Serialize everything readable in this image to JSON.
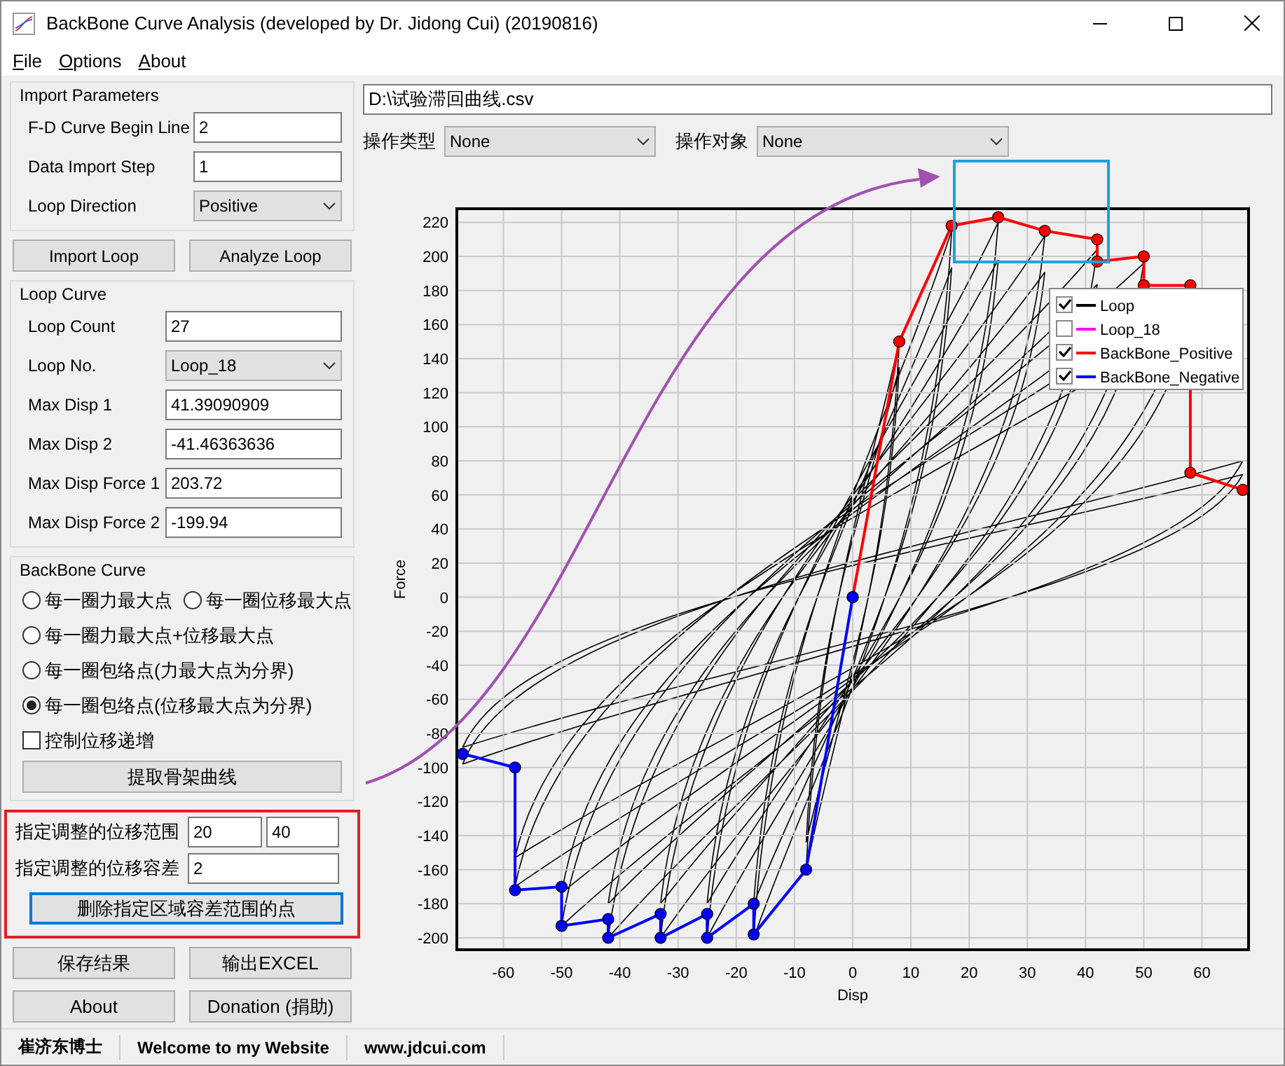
{
  "window": {
    "title": "BackBone Curve Analysis (developed by Dr. Jidong Cui) (20190816)"
  },
  "menu": [
    "File",
    "Options",
    "About"
  ],
  "import_parameters": {
    "title": "Import Parameters",
    "fields": [
      {
        "label": "F-D Curve Begin Line",
        "kind": "input",
        "value": "2"
      },
      {
        "label": "Data Import Step",
        "kind": "input",
        "value": "1"
      },
      {
        "label": "Loop Direction",
        "kind": "select",
        "value": "Positive"
      }
    ]
  },
  "loop_buttons": [
    "Import Loop",
    "Analyze Loop"
  ],
  "loop_curve": {
    "title": "Loop Curve",
    "fields": [
      {
        "label": "Loop Count",
        "kind": "input",
        "value": "27"
      },
      {
        "label": "Loop No.",
        "kind": "select",
        "value": "Loop_18"
      },
      {
        "label": "Max Disp 1",
        "kind": "input",
        "value": "41.39090909"
      },
      {
        "label": "Max Disp 2",
        "kind": "input",
        "value": "-41.46363636"
      },
      {
        "label": "Max Disp Force 1",
        "kind": "input",
        "value": "203.72"
      },
      {
        "label": "Max Disp Force 2",
        "kind": "input",
        "value": "-199.94"
      }
    ]
  },
  "backbone_curve": {
    "title": "BackBone Curve",
    "option_rows": [
      [
        {
          "label": "每一圈力最大点",
          "selected": false
        },
        {
          "label": "每一圈位移最大点",
          "selected": false
        }
      ],
      [
        {
          "label": "每一圈力最大点+位移最大点",
          "selected": false
        }
      ],
      [
        {
          "label": "每一圈包络点(力最大点为分界)",
          "selected": false
        }
      ],
      [
        {
          "label": "每一圈包络点(位移最大点为分界)",
          "selected": true
        }
      ]
    ],
    "checkbox": {
      "label": "控制位移递增",
      "checked": false
    },
    "button": "提取骨架曲线"
  },
  "adjust": {
    "highlighted": true,
    "range_label": "指定调整的位移范围",
    "range_from": "20",
    "range_to": "40",
    "tolerance_label": "指定调整的位移容差",
    "tolerance": "2",
    "button": {
      "label": "删除指定区域容差范围的点",
      "focused": true
    }
  },
  "bottom_buttons": [
    "保存结果",
    "输出EXCEL",
    "About",
    "Donation (捐助)"
  ],
  "file_path": "D:\\试验滞回曲线.csv",
  "selectors": [
    {
      "label": "操作类型",
      "value": "None"
    },
    {
      "label": "操作对象",
      "value": "None"
    }
  ],
  "chart": {
    "legend": [
      {
        "kind": "extra",
        "label": "Loop",
        "checked": true,
        "color": "#000000"
      },
      {
        "kind": "extra",
        "label": "Loop_18",
        "checked": false,
        "color": "#ff00ff"
      },
      {
        "kind": "series",
        "checked": true
      },
      {
        "kind": "series",
        "checked": true
      }
    ],
    "chart_data": {
      "type": "line",
      "grid": true,
      "legend": true,
      "xlabel": "Disp",
      "ylabel": "Force",
      "xlim": [
        -68,
        68
      ],
      "ylim": [
        -207,
        228
      ],
      "xticks": [
        -60,
        -50,
        -40,
        -30,
        -20,
        -10,
        0,
        10,
        20,
        30,
        40,
        50,
        60
      ],
      "yticks": [
        -200,
        -180,
        -160,
        -140,
        -120,
        -100,
        -80,
        -60,
        -40,
        -20,
        0,
        20,
        40,
        60,
        80,
        100,
        120,
        140,
        160,
        180,
        200,
        220
      ],
      "x": [
        -67,
        -58,
        -58,
        -50,
        -50,
        -42,
        -42,
        -33,
        -33,
        -25,
        -25,
        -17,
        -17,
        -8,
        0,
        8,
        17,
        25,
        33,
        42,
        42,
        50,
        50,
        58,
        58,
        67
      ],
      "series": [
        {
          "name": "BackBone_Positive",
          "color": "#ff0000",
          "marker": "circle",
          "values": [
            null,
            null,
            null,
            null,
            null,
            null,
            null,
            null,
            null,
            null,
            null,
            null,
            null,
            null,
            0,
            150,
            218,
            223,
            215,
            210,
            197,
            200,
            183,
            183,
            73,
            63
          ]
        },
        {
          "name": "BackBone_Negative",
          "color": "#0000ff",
          "marker": "circle",
          "values": [
            -92,
            -100,
            -172,
            -170,
            -193,
            -189,
            -200,
            -186,
            -200,
            -186,
            -200,
            -180,
            -198,
            -160,
            0,
            null,
            null,
            null,
            null,
            null,
            null,
            null,
            null,
            null,
            null,
            null
          ]
        }
      ]
    },
    "annotations": [
      {
        "kind": "arrow",
        "color": "#a050b0"
      },
      {
        "kind": "box",
        "color": "#1ea0e0"
      }
    ]
  },
  "status_bar": [
    "崔济东博士",
    "Welcome to my Website",
    "www.jdcui.com"
  ]
}
